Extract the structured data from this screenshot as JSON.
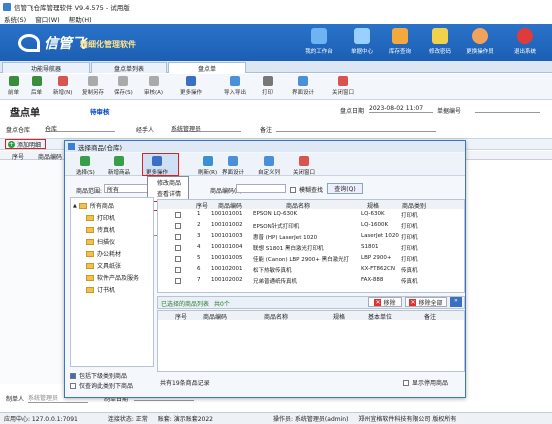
{
  "window": {
    "title": "信管飞仓库管理软件 V9.4.575 - 试用版"
  },
  "menu": [
    "系统(S)",
    "窗口(W)",
    "帮助(H)"
  ],
  "banner": {
    "brand": "信管飞",
    "slogan": "精细化管理软件",
    "buttons": [
      "我的工作台",
      "单据中心",
      "库存查询",
      "修改密码",
      "更换操作员",
      "退出系统"
    ]
  },
  "tabs": [
    "功能导航器",
    "盘点单列表",
    "盘点单"
  ],
  "toolbar": [
    "前单",
    "后单",
    "新增(N)",
    "复制另存",
    "保存(S)",
    "审核(A)",
    "更多操作",
    "导入导出",
    "打印",
    "界面设计",
    "关闭窗口"
  ],
  "doc": {
    "title": "盘点单",
    "status": "待审核",
    "date_label": "盘点日期",
    "date": "2023-08-02 11:07",
    "no_label": "单据编号"
  },
  "form": {
    "warehouse_label": "盘点仓库",
    "warehouse": "仓库",
    "handler_label": "经手人",
    "handler": "系统管理员",
    "remark_label": "备注"
  },
  "add_label": "添加明细",
  "grid_headers": [
    "序号",
    "商品编码"
  ],
  "bottom": {
    "maker_label": "制单人",
    "maker": "系统管理员",
    "date_label": "制单日期",
    "date": "2023-8-2"
  },
  "status": {
    "server": "应用中心: 127.0.0.1:7091",
    "conn": "连接状态: 正常",
    "account": "账套: 演示账套2022",
    "operator": "操作员: 系统管理员(admin)",
    "company": "郑州宜格软件科技有限公司 版权所有"
  },
  "dialog": {
    "title": "选择商品(仓库)",
    "tools": [
      "选择(S)",
      "新增商品",
      "更多操作",
      "刷新(R)",
      "界面设计",
      "自定义列",
      "关闭窗口"
    ],
    "menu": [
      "修改商品",
      "查看详情",
      "全选",
      "反选",
      "全不选"
    ],
    "scope_label": "商品范围:",
    "scope": "所有",
    "code_label": "商品编码(F):",
    "fuzzy": "模糊查找",
    "query": "查询(Q)",
    "tree": [
      "所有商品",
      "打印机",
      "传真机",
      "扫描仪",
      "办公耗材",
      "文具纸张",
      "软件产品及服务",
      "订书机"
    ],
    "cols": [
      "序号",
      "商品编码",
      "商品名称",
      "规格",
      "商品类别"
    ],
    "rows": [
      [
        "1",
        "100101001",
        "EPSON LQ-630K",
        "LQ-630K",
        "打印机"
      ],
      [
        "2",
        "100101002",
        "EPSON针式打印机",
        "LQ-1600K",
        "打印机"
      ],
      [
        "3",
        "100101003",
        "惠普 (HP) LaserJet 1020",
        "LaserJet 1020",
        "打印机"
      ],
      [
        "4",
        "100101004",
        "联想 S1801 黑白激光打印机",
        "S1801",
        "打印机"
      ],
      [
        "5",
        "100101005",
        "佳能 (Canon) LBP 2900+ 黑白激光打",
        "LBP 2900+",
        "打印机"
      ],
      [
        "6",
        "100102001",
        "松下热敏传真机",
        "KX-FT862CN",
        "传真机"
      ],
      [
        "7",
        "100102002",
        "兄弟普通纸传真机",
        "FAX-888",
        "传真机"
      ]
    ],
    "selected_label": "已选择的商品列表",
    "selected_count": "共0个",
    "remove": "移除",
    "remove_all": "移除全部",
    "bot_cols": [
      "序号",
      "商品编码",
      "商品名称",
      "规格",
      "基本单位",
      "备注"
    ],
    "include_sub": "包括下级类别商品",
    "only_current": "仅查询此类别下商品",
    "record_count": "共有19条商品记录",
    "show_disabled": "显示停用商品"
  }
}
